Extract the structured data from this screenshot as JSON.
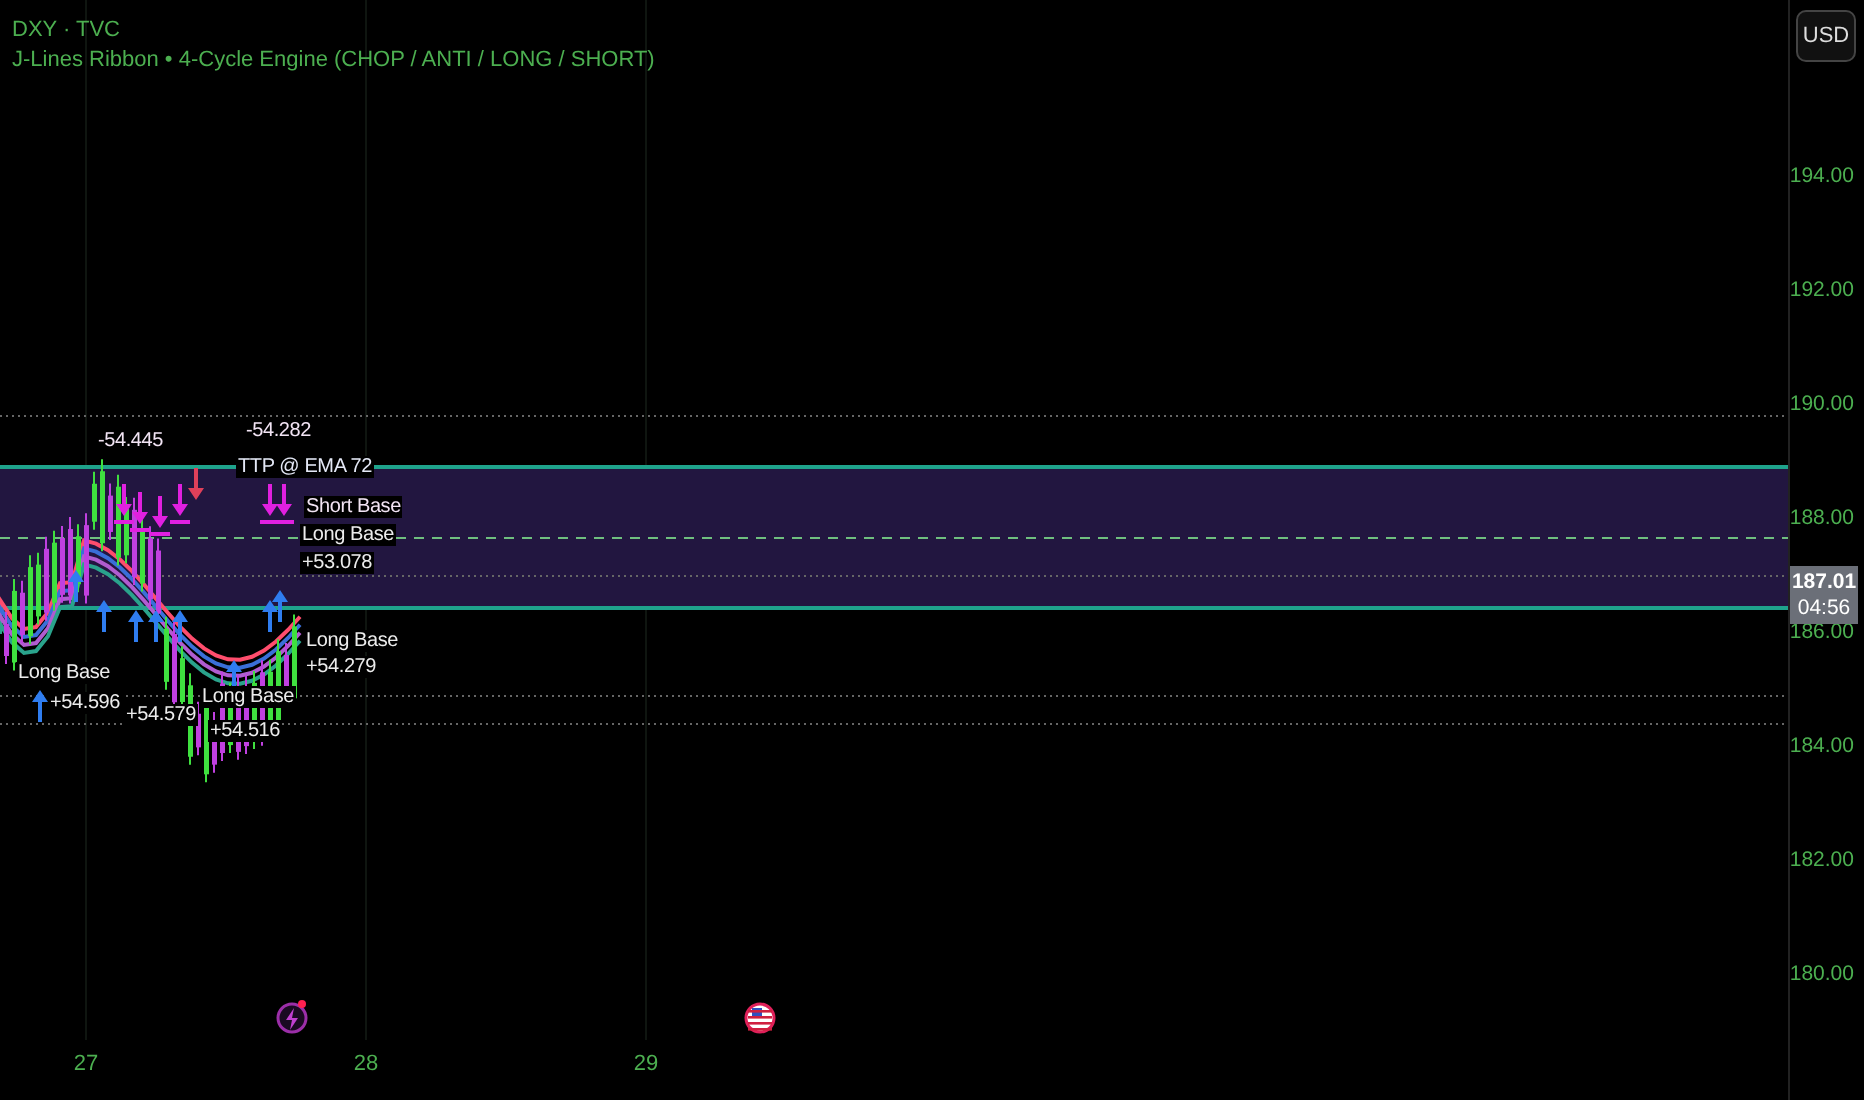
{
  "header": {
    "symbol": "DXY · TVC",
    "indicator": "J-Lines Ribbon • 4-Cycle Engine (CHOP / ANTI / LONG / SHORT)"
  },
  "currency_button": "USD",
  "price_axis": [
    "194.00",
    "192.00",
    "190.00",
    "188.00",
    "186.00",
    "184.00",
    "182.00",
    "180.00"
  ],
  "price_badge": {
    "price": "187.01",
    "countdown": "04:56"
  },
  "time_axis": [
    "27",
    "28",
    "29"
  ],
  "chart_labels": [
    {
      "kind": "short",
      "text": "-54.282"
    },
    {
      "kind": "short",
      "text": "-54.445"
    },
    {
      "kind": "tp",
      "text": "TTP @ EMA 72"
    },
    {
      "kind": "short",
      "text": "Short Base"
    },
    {
      "kind": "long",
      "text": "Long Base"
    },
    {
      "kind": "long",
      "text": "+53.078"
    },
    {
      "kind": "long",
      "text": "Long Base"
    },
    {
      "kind": "long",
      "text": "+54.279"
    },
    {
      "kind": "long",
      "text": "Long Base"
    },
    {
      "kind": "long",
      "text": "Long Base"
    },
    {
      "kind": "long",
      "text": "+54.596"
    },
    {
      "kind": "long",
      "text": "+54.579"
    },
    {
      "kind": "long",
      "text": "+54.516"
    }
  ]
}
